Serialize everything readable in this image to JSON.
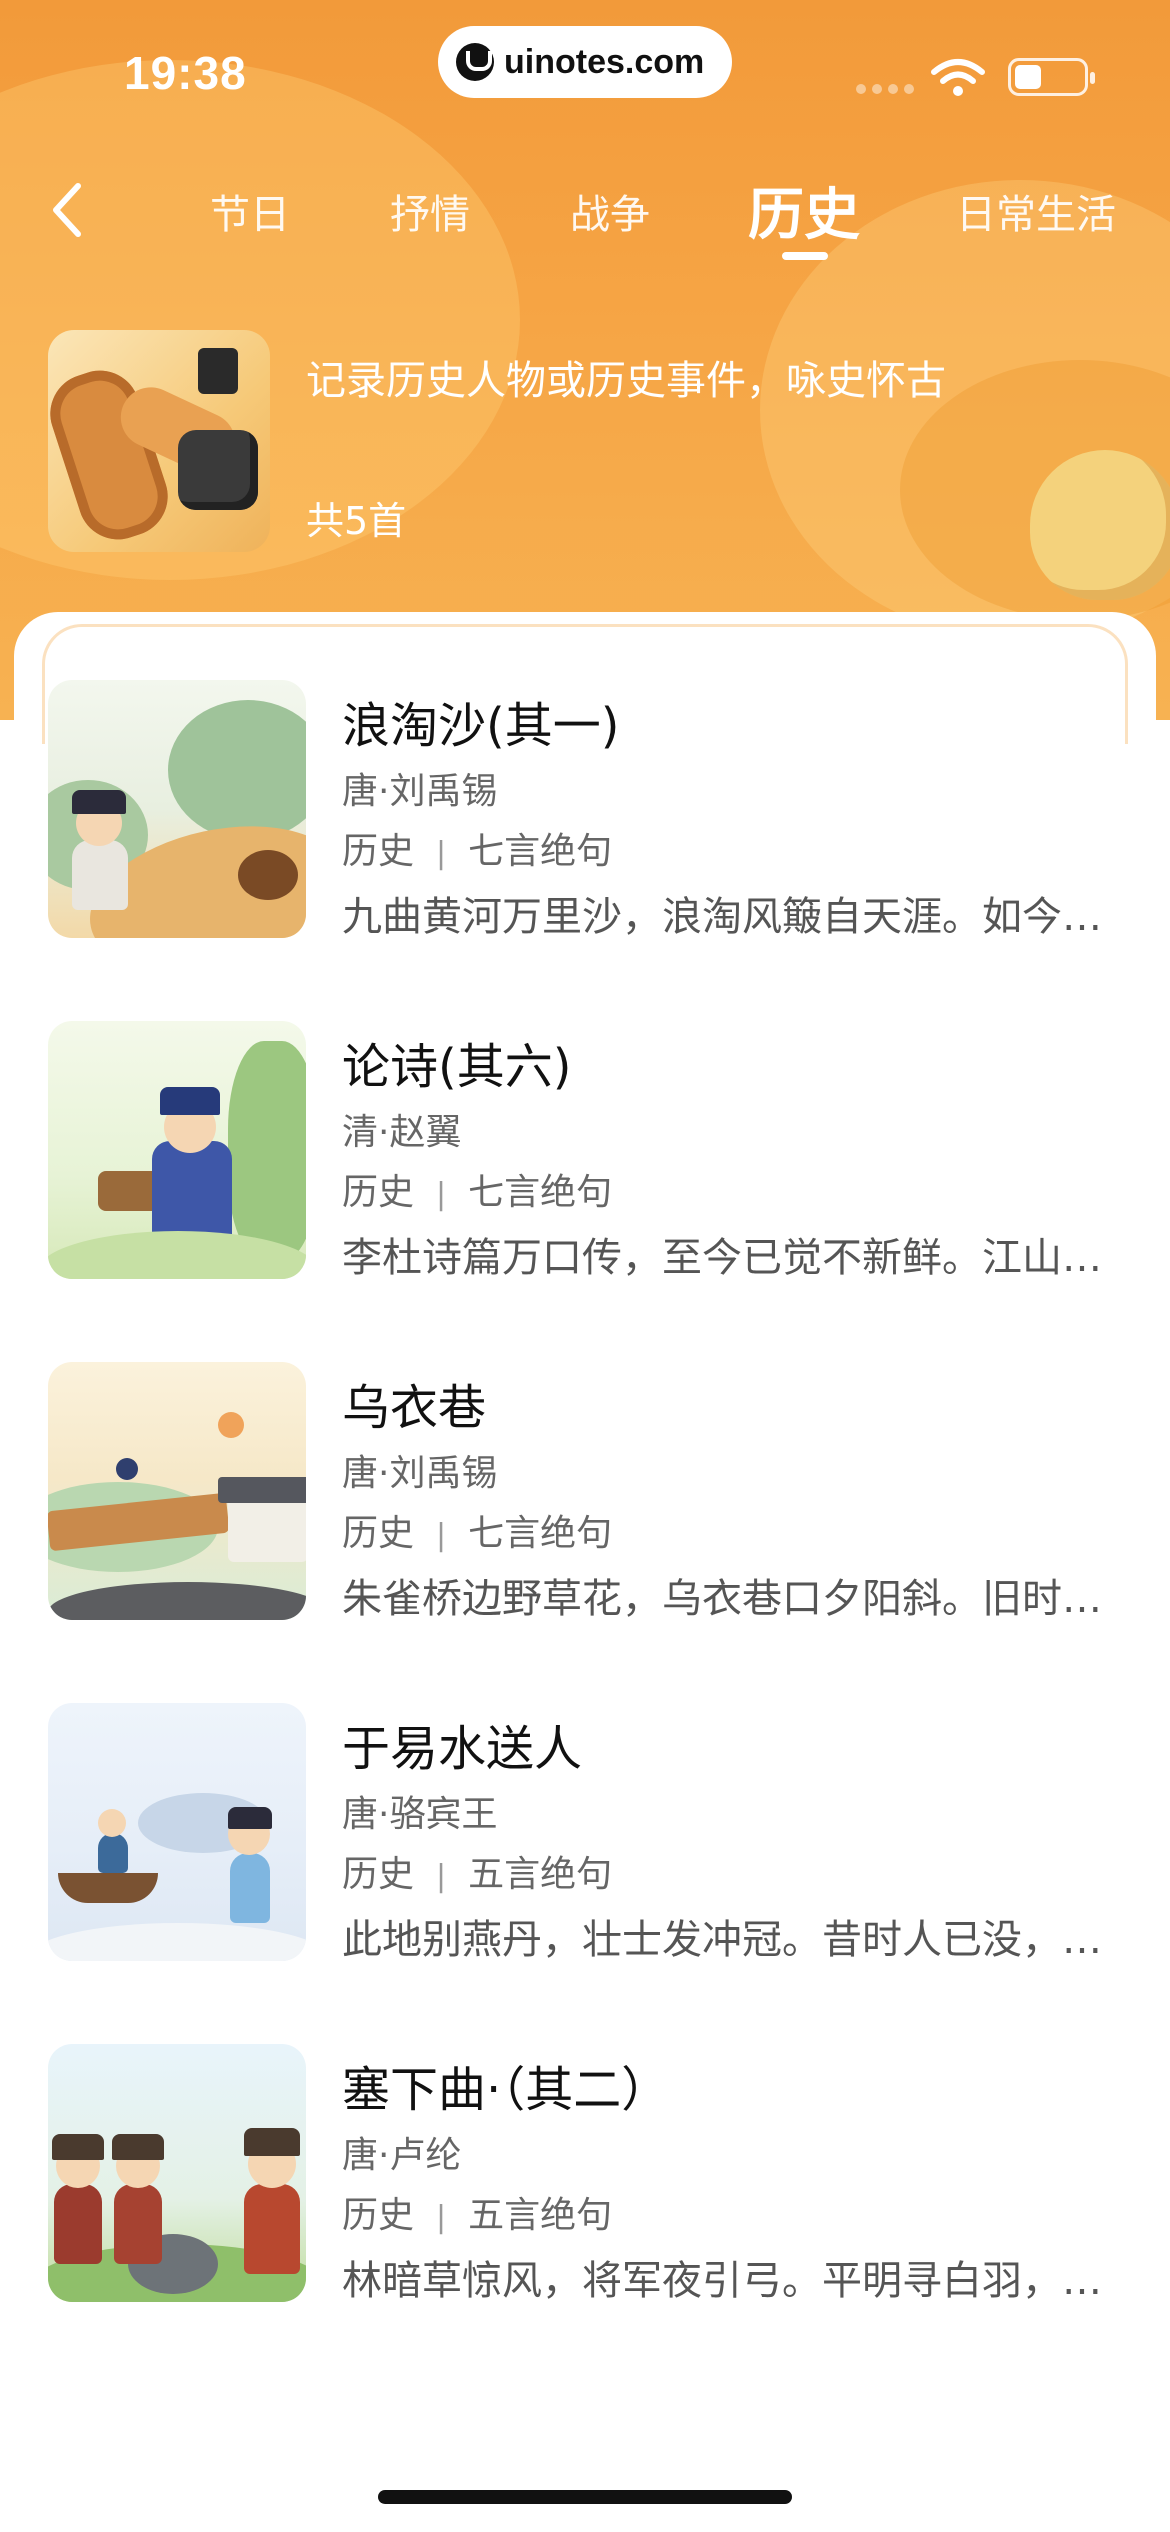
{
  "status_bar": {
    "time": "19:38",
    "url": "uinotes.com"
  },
  "nav": {
    "back_icon": "chevron-left-icon",
    "tabs": [
      {
        "label": "节日",
        "active": false
      },
      {
        "label": "抒情",
        "active": false
      },
      {
        "label": "战争",
        "active": false
      },
      {
        "label": "历史",
        "active": true
      },
      {
        "label": "日常生活",
        "active": false
      }
    ]
  },
  "category": {
    "description": "记录历史人物或历史事件，咏史怀古",
    "count": "共5首"
  },
  "poems": [
    {
      "title": "浪淘沙(其一)",
      "author": "唐·刘禹锡",
      "tag": "历史",
      "form": "七言绝句",
      "excerpt": "九曲黄河万里沙，浪淘风簸自天涯。如今直上银河去，同到牵牛织女家。"
    },
    {
      "title": "论诗(其六)",
      "author": "清·赵翼",
      "tag": "历史",
      "form": "七言绝句",
      "excerpt": "李杜诗篇万口传，至今已觉不新鲜。江山代有才人出，各领风骚数百年。"
    },
    {
      "title": "乌衣巷",
      "author": "唐·刘禹锡",
      "tag": "历史",
      "form": "七言绝句",
      "excerpt": "朱雀桥边野草花，乌衣巷口夕阳斜。旧时王谢堂前燕，飞入寻常百姓家。"
    },
    {
      "title": "于易水送人",
      "author": "唐·骆宾王",
      "tag": "历史",
      "form": "五言绝句",
      "excerpt": "此地别燕丹，壮士发冲冠。昔时人已没，今日水犹寒。"
    },
    {
      "title": "塞下曲·（其二）",
      "author": "唐·卢纶",
      "tag": "历史",
      "form": "五言绝句",
      "excerpt": "林暗草惊风，将军夜引弓。平明寻白羽，没在石棱中。"
    }
  ],
  "theme": {
    "header_orange": "#f29a3a",
    "text_primary": "#111111",
    "text_secondary": "#666666"
  }
}
